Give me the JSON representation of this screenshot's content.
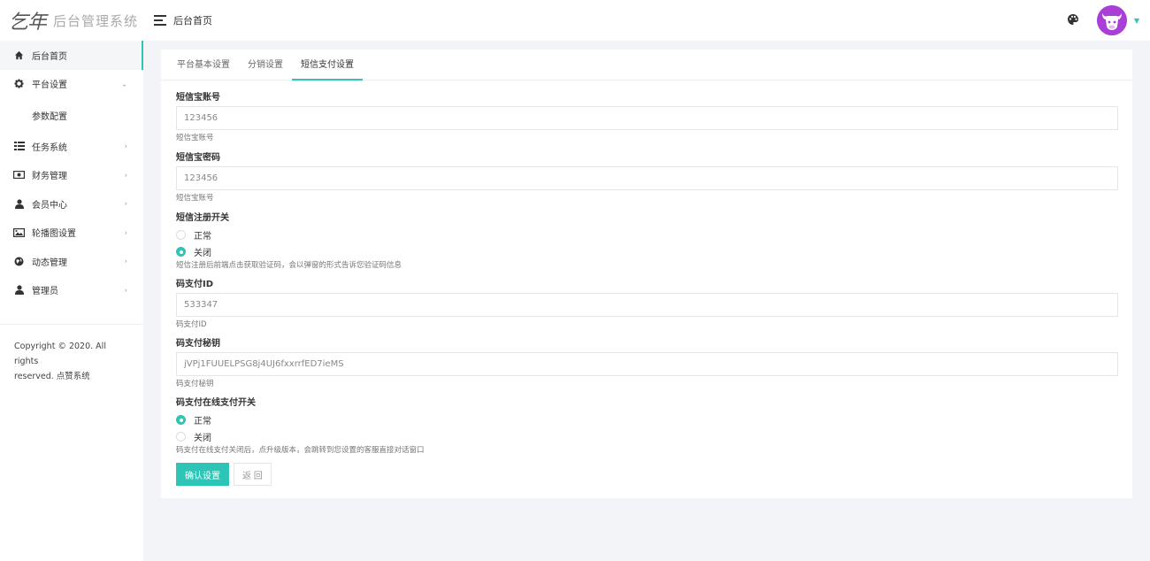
{
  "logo": {
    "mark": "乞年",
    "text": "后台管理系统"
  },
  "sidebar": {
    "items": [
      {
        "label": "后台首页",
        "icon": "home-icon",
        "arrow": ""
      },
      {
        "label": "平台设置",
        "icon": "gear-icon",
        "arrow": "⌄"
      },
      {
        "label": "任务系统",
        "icon": "list-icon",
        "arrow": "›"
      },
      {
        "label": "财务管理",
        "icon": "money-icon",
        "arrow": "›"
      },
      {
        "label": "会员中心",
        "icon": "user-icon",
        "arrow": "›"
      },
      {
        "label": "轮播图设置",
        "icon": "image-icon",
        "arrow": "›"
      },
      {
        "label": "动态管理",
        "icon": "globe-icon",
        "arrow": "›"
      },
      {
        "label": "管理员",
        "icon": "admin-icon",
        "arrow": "›"
      }
    ],
    "submenu": {
      "label": "参数配置"
    },
    "copyright_line1": "Copyright © 2020. All rights",
    "copyright_line2": "reserved. 点赞系统"
  },
  "header": {
    "title": "后台首页"
  },
  "tabs": [
    {
      "label": "平台基本设置"
    },
    {
      "label": "分销设置"
    },
    {
      "label": "短信支付设置"
    }
  ],
  "form": {
    "sms_account": {
      "label": "短信宝账号",
      "value": "123456",
      "hint": "短信宝账号"
    },
    "sms_password": {
      "label": "短信宝密码",
      "value": "123456",
      "hint": "短信宝账号"
    },
    "sms_switch": {
      "label": "短信注册开关",
      "opt_on": "正常",
      "opt_off": "关闭",
      "selected": "关闭",
      "hint": "短信注册后前端点击获取验证码，会以弹窗的形式告诉您验证码信息"
    },
    "pay_id": {
      "label": "码支付ID",
      "value": "533347",
      "hint": "码支付ID"
    },
    "pay_secret": {
      "label": "码支付秘钥",
      "value": "jVPj1FUUELPSG8j4UJ6fxxrrfED7ieMS",
      "hint": "码支付秘钥"
    },
    "pay_switch": {
      "label": "码支付在线支付开关",
      "opt_on": "正常",
      "opt_off": "关闭",
      "selected": "正常",
      "hint": "码支付在线支付关闭后，点升级版本，会跳转到您设置的客服直接对话窗口"
    },
    "confirm_label": "确认设置",
    "back_label": "返 回"
  },
  "colors": {
    "accent": "#2ec4b6",
    "avatar": "#a93fd6"
  }
}
